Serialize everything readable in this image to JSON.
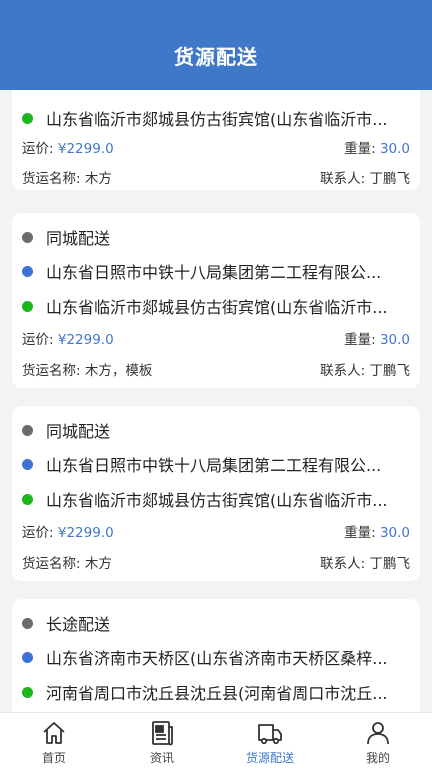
{
  "header": {
    "title": "货源配送"
  },
  "labels": {
    "price": "运价:",
    "weight": "重量:",
    "goods": "货运名称:",
    "contact": "联系人:"
  },
  "orders": [
    {
      "origin": "",
      "to": "山东省临沂市郯城县仿古街宾馆(山东省临沂市...",
      "price": "¥2299.0",
      "weight": "30.0",
      "goods": "木方",
      "contact": "丁鹏飞"
    },
    {
      "type": "同城配送",
      "from": "山东省日照市中铁十八局集团第二工程有限公...",
      "to": "山东省临沂市郯城县仿古街宾馆(山东省临沂市...",
      "price": "¥2299.0",
      "weight": "30.0",
      "goods": "木方，模板",
      "contact": "丁鹏飞"
    },
    {
      "type": "同城配送",
      "from": "山东省日照市中铁十八局集团第二工程有限公...",
      "to": "山东省临沂市郯城县仿古街宾馆(山东省临沂市...",
      "price": "¥2299.0",
      "weight": "30.0",
      "goods": "木方",
      "contact": "丁鹏飞"
    },
    {
      "type": "长途配送",
      "from": "山东省济南市天桥区(山东省济南市天桥区桑梓...",
      "to": "河南省周口市沈丘县沈丘县(河南省周口市沈丘..."
    }
  ],
  "tabs": [
    {
      "label": "首页",
      "icon": "home-icon"
    },
    {
      "label": "资讯",
      "icon": "news-icon"
    },
    {
      "label": "货源配送",
      "icon": "delivery-truck-icon",
      "active": true
    },
    {
      "label": "我的",
      "icon": "user-icon"
    }
  ],
  "colors": {
    "brand": "#3f78c9",
    "dot_type": "#6b6b6b",
    "dot_from": "#3d72d6",
    "dot_to": "#1bb61e"
  }
}
